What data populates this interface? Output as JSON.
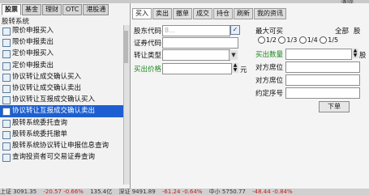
{
  "left_tabs": [
    "股票",
    "基金",
    "理财",
    "OTC",
    "港股通"
  ],
  "tree_root": "股转系统",
  "tree_items": [
    "限价申报买入",
    "限价申报卖出",
    "定价申报买入",
    "定价申报卖出",
    "协议转让成交确认买入",
    "协议转让成交确认卖出",
    "协议转让互报成交确认买入",
    "协议转让互报成交确认卖出",
    "股转系统委托查询",
    "股转系统委托撤单",
    "股转系统协议转让申报信息查询",
    "查询投资者可交易证券查询"
  ],
  "selected_index": 7,
  "right_tabs": [
    "买入",
    "卖出",
    "撤单",
    "成交",
    "持仓",
    "刷新",
    "我的资讯"
  ],
  "form": {
    "stock_code_label": "股东代码",
    "stock_code_value": "8...",
    "security_code_label": "证券代码",
    "transfer_type_label": "转让类型",
    "price_label": "买出价格",
    "price_unit": "元",
    "max_label": "最大可买",
    "all_label": "全部",
    "unit_gu": "股",
    "unit_gu2": "股",
    "radios": [
      "1/2",
      "1/3",
      "1/4",
      "1/5"
    ],
    "qty_label": "买出数量",
    "counterparty_seat_label": "对方席位",
    "counterparty_account_label": "对方席位",
    "agreed_no_label": "约定序号",
    "submit_label": "下单",
    "checkbox_mark": "✓"
  },
  "top_right_text": "清除",
  "status": {
    "a": "上证 3091.35",
    "b": "-20.57 -0.66%",
    "c": "135.4亿",
    "d": "深证 9491.89",
    "e": "-61.24 -0.64%",
    "f": "中小 5750.77",
    "g": "-48.44 -0.84%"
  }
}
